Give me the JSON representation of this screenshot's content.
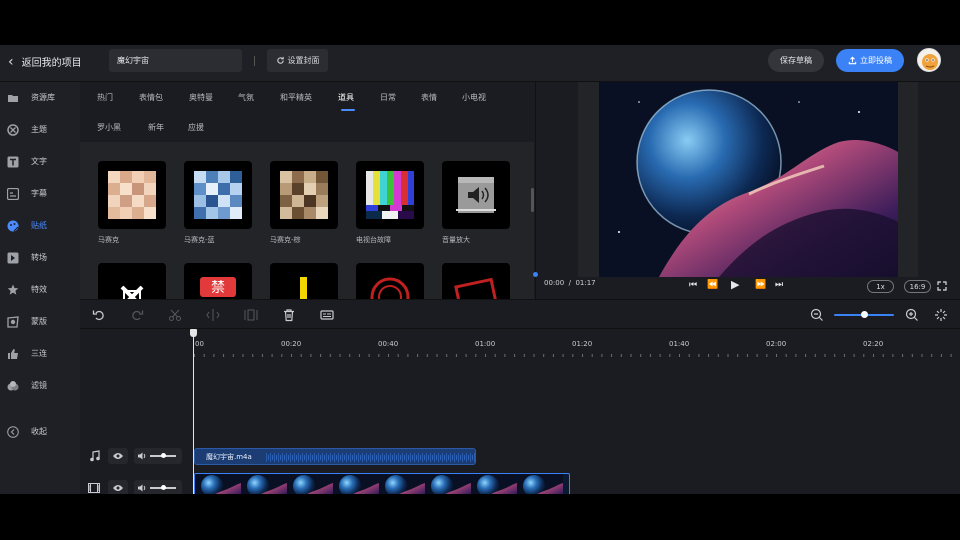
{
  "header": {
    "back_label": "返回我的项目",
    "project_title": "魔幻宇宙",
    "cover_label": "设置封面",
    "save_label": "保存草稿",
    "publish_label": "立即投稿"
  },
  "sidebar": {
    "items": [
      {
        "label": "资源库",
        "icon": "folder-icon"
      },
      {
        "label": "主题",
        "icon": "theme-icon"
      },
      {
        "label": "文字",
        "icon": "text-icon"
      },
      {
        "label": "字幕",
        "icon": "subtitle-icon"
      },
      {
        "label": "贴纸",
        "icon": "sticker-icon",
        "active": true
      },
      {
        "label": "转场",
        "icon": "transition-icon"
      },
      {
        "label": "特效",
        "icon": "effects-icon"
      },
      {
        "label": "蒙版",
        "icon": "mask-icon"
      },
      {
        "label": "三连",
        "icon": "thumbs-up-icon"
      },
      {
        "label": "滤镜",
        "icon": "filter-icon"
      }
    ],
    "collapse_label": "收起"
  },
  "sticker_panel": {
    "tabs_row1": [
      "热门",
      "表情包",
      "奥特曼",
      "气氛",
      "和平精英",
      "道具",
      "日常",
      "表情",
      "小电视"
    ],
    "tabs_row2": [
      "罗小黑",
      "新年",
      "应援"
    ],
    "active_tab": "道具",
    "stickers": [
      "马赛克",
      "马赛克-蓝",
      "马赛克-棕",
      "电视台故障",
      "音量放大"
    ],
    "row2_texts": [
      "禁"
    ]
  },
  "preview": {
    "current_time": "00:00",
    "separator": "/",
    "total_time": "01:17",
    "speed": "1x",
    "aspect": "16:9"
  },
  "timeline": {
    "ruler": [
      "00",
      "00:20",
      "00:40",
      "01:00",
      "01:20",
      "01:40",
      "02:00",
      "02:20"
    ],
    "audio_clip_name": "魔幻宇宙.m4a"
  },
  "colors": {
    "accent": "#3b82f6",
    "active_sidebar": "#4a8cff",
    "background": "#1b1c21"
  }
}
